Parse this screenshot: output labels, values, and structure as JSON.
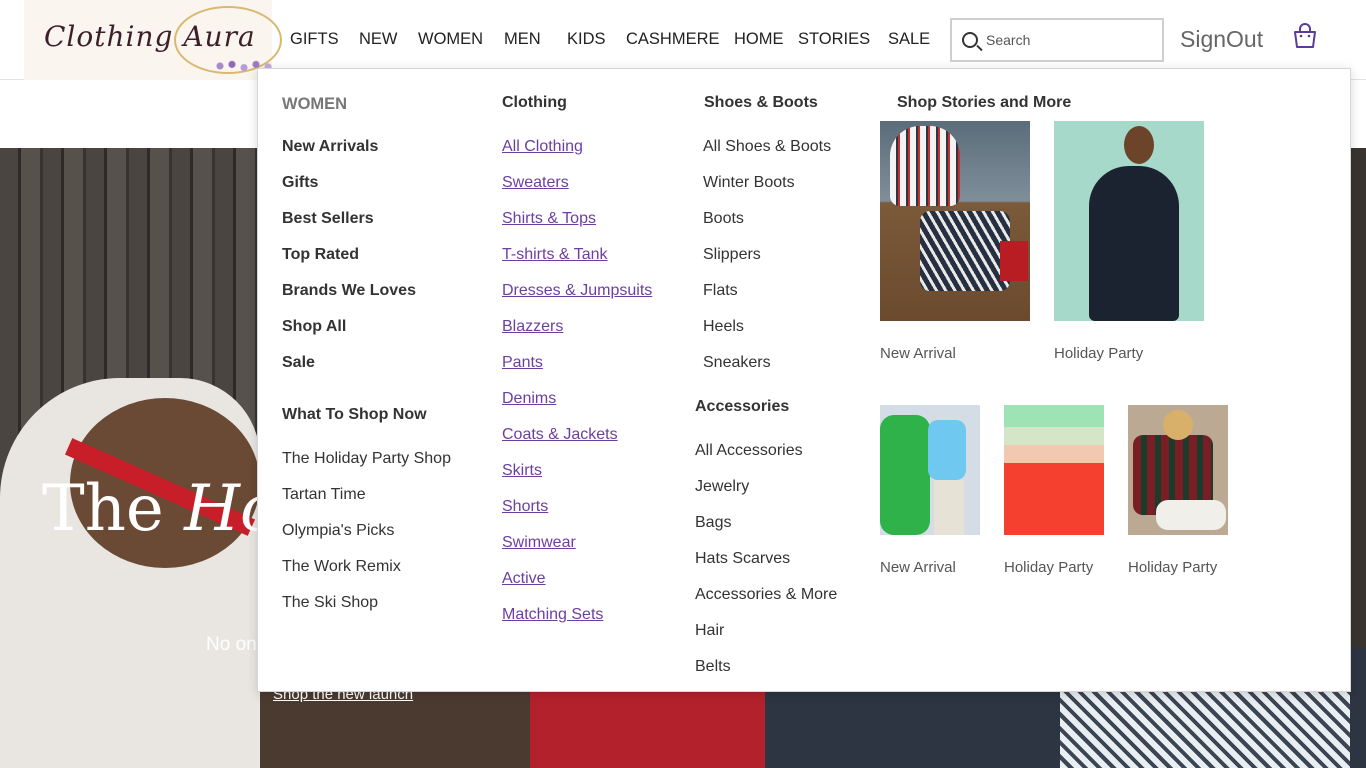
{
  "logo": {
    "text": "Clothing Aura"
  },
  "nav": [
    {
      "label": "GIFTS"
    },
    {
      "label": "NEW"
    },
    {
      "label": "WOMEN"
    },
    {
      "label": "MEN"
    },
    {
      "label": "KIDS"
    },
    {
      "label": "CASHMERE"
    },
    {
      "label": "HOME"
    },
    {
      "label": "STORIES"
    },
    {
      "label": "SALE"
    }
  ],
  "search": {
    "placeholder": "Search",
    "value": ""
  },
  "account": {
    "signout_label": "SignOut"
  },
  "hero": {
    "title_plain": "The ",
    "title_italic": "Hol",
    "subtitle": "No on",
    "link": "Shop the new launch"
  },
  "menu": {
    "women": {
      "heading": "WOMEN",
      "items": [
        "New Arrivals",
        "Gifts",
        "Best Sellers",
        "Top Rated",
        "Brands We Loves",
        "Shop All",
        "Sale"
      ],
      "what_heading": "What To Shop Now",
      "what_items": [
        "The Holiday Party Shop",
        "Tartan Time",
        "Olympia's Picks",
        "The Work Remix",
        "The Ski Shop"
      ]
    },
    "clothing": {
      "heading": "Clothing",
      "items": [
        "All Clothing",
        "Sweaters",
        "Shirts & Tops",
        "T-shirts & Tank",
        "Dresses & Jumpsuits",
        "Blazzers",
        "Pants",
        "Denims",
        "Coats & Jackets",
        "Skirts",
        "Shorts",
        "Swimwear",
        "Active",
        "Matching Sets"
      ]
    },
    "shoes": {
      "heading": "Shoes & Boots",
      "items": [
        "All Shoes & Boots",
        "Winter Boots",
        "Boots",
        "Slippers",
        "Flats",
        "Heels",
        "Sneakers"
      ]
    },
    "accessories": {
      "heading": "Accessories",
      "items": [
        "All Accessories",
        "Jewelry",
        "Bags",
        "Hats Scarves",
        "Accessories & More",
        "Hair",
        "Belts"
      ]
    },
    "stories": {
      "heading": "Shop Stories and More",
      "tiles": [
        {
          "caption": "New Arrival"
        },
        {
          "caption": "Holiday Party"
        },
        {
          "caption": "New Arrival"
        },
        {
          "caption": "Holiday Party"
        },
        {
          "caption": "Holiday Party"
        }
      ]
    }
  }
}
